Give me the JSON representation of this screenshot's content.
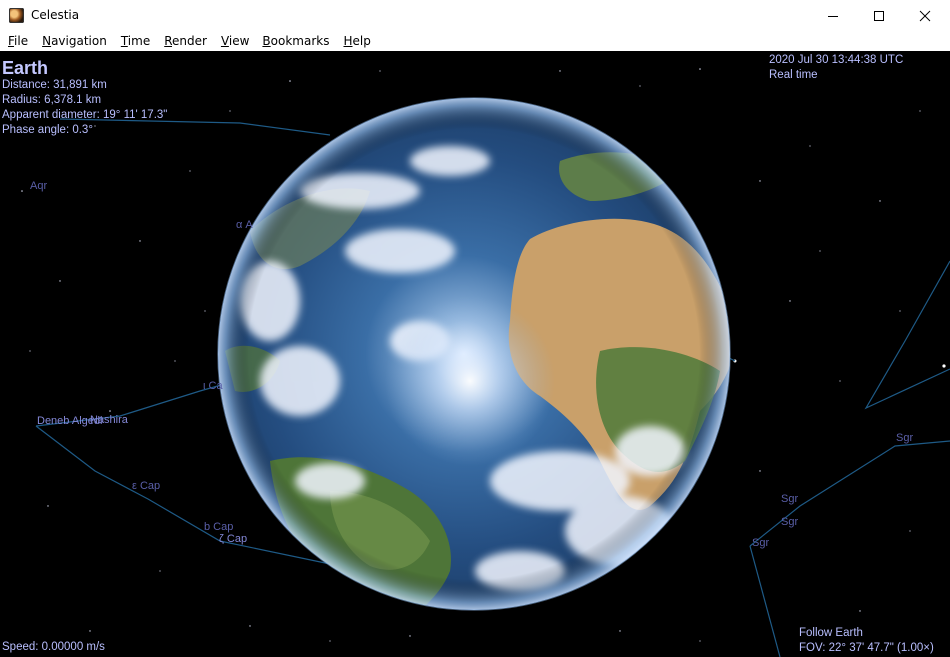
{
  "window": {
    "title": "Celestia",
    "app_icon": "celestia-app-icon",
    "controls": [
      "minimize-icon",
      "maximize-icon",
      "close-icon"
    ]
  },
  "menu": {
    "items": [
      {
        "label": "File",
        "mnemonic": "F",
        "rest": "ile"
      },
      {
        "label": "Navigation",
        "mnemonic": "N",
        "rest": "avigation"
      },
      {
        "label": "Time",
        "mnemonic": "T",
        "rest": "ime"
      },
      {
        "label": "Render",
        "mnemonic": "R",
        "rest": "ender"
      },
      {
        "label": "View",
        "mnemonic": "V",
        "rest": "iew"
      },
      {
        "label": "Bookmarks",
        "mnemonic": "B",
        "rest": "ookmarks"
      },
      {
        "label": "Help",
        "mnemonic": "H",
        "rest": "elp"
      }
    ]
  },
  "hud": {
    "object_name": "Earth",
    "distance": "Distance: 31,891 km",
    "radius": "Radius: 6,378.1 km",
    "apparent_diameter": "Apparent diameter: 19° 11' 17.3\"",
    "phase_angle": "Phase angle: 0.3°",
    "datetime": "2020 Jul 30 13:44:38 UTC",
    "time_mode": "Real time",
    "speed": "Speed: 0.00000 m/s",
    "follow": "Follow Earth",
    "fov": "FOV: 22° 37' 47.7\" (1.00×)"
  },
  "constellation_labels": {
    "aqr": "Aqr",
    "alpha_a": "α A",
    "iota_cap": "ι Ca",
    "deneb_algedi": "Deneb Algedi",
    "nashira": "Nashira",
    "epsilon_cap": "ε Cap",
    "b_cap": "b Cap",
    "zeta_cap": "ζ Cap",
    "sgr1": "Sgr",
    "sgr2": "Sgr",
    "sgr3": "Sgr",
    "sgr4": "Sgr"
  },
  "colors": {
    "hud_text": "#b9bfff",
    "constellation_line": "#1e5a86",
    "background": "#000000"
  }
}
